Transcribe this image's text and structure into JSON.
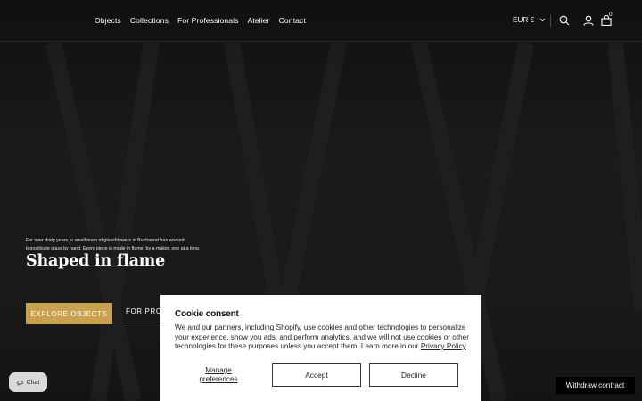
{
  "header": {
    "nav": [
      "Objects",
      "Collections",
      "For Professionals",
      "Atelier",
      "Contact"
    ],
    "currency": "EUR €",
    "cart_count": "0"
  },
  "hero": {
    "intro_line1": "For over thirty years, a small team of glassblowers in Bucharest has worked",
    "intro_line2": "borosilicate glass by hand. Every piece is made in flame, by a maker, one at a time.",
    "title": "Shaped in flame",
    "primary_button": "EXPLORE OBJECTS",
    "secondary_link": "FOR PROF"
  },
  "chat": {
    "label": "Chat"
  },
  "cookie": {
    "title": "Cookie consent",
    "text": "We and our partners, including Shopify, use cookies and other technologies to personalize your experience, show you ads, and perform analytics, and we will not use cookies or other technologies for these purposes unless you accept them. Learn more in our ",
    "privacy_link": "Privacy Policy",
    "manage_label": "Manage preferences",
    "accept_label": "Accept",
    "decline_label": "Decline"
  },
  "withdraw": {
    "label": "Withdraw contract"
  },
  "icons": {
    "search": "search-icon",
    "account": "user-icon",
    "cart": "shopping-bag-icon",
    "currency_toggle": "chevron-down-icon",
    "chat": "chat-bubble-icon"
  },
  "colors": {
    "background": "#151515",
    "accent_button": "#c9a14f",
    "cookie_panel": "#ffffff",
    "withdraw_button": "#000000"
  }
}
